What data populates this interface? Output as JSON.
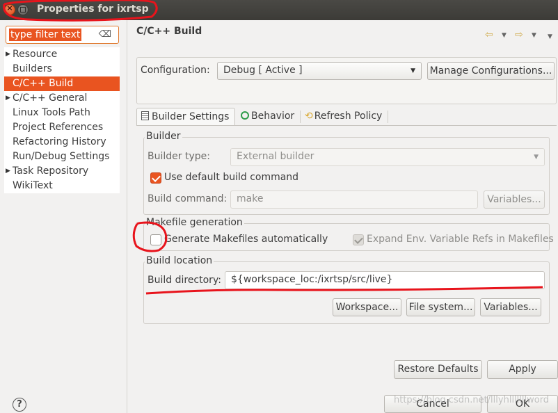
{
  "window": {
    "title": "Properties for ixrtsp"
  },
  "filter": {
    "placeholder": "type filter text",
    "clear_icon": "clear-icon"
  },
  "tree": {
    "items": [
      {
        "label": "Resource",
        "has_children": true
      },
      {
        "label": "Builders",
        "has_children": false
      },
      {
        "label": "C/C++ Build",
        "has_children": false,
        "selected": true
      },
      {
        "label": "C/C++ General",
        "has_children": true
      },
      {
        "label": "Linux Tools Path",
        "has_children": false
      },
      {
        "label": "Project References",
        "has_children": false
      },
      {
        "label": "Refactoring History",
        "has_children": false
      },
      {
        "label": "Run/Debug Settings",
        "has_children": false
      },
      {
        "label": "Task Repository",
        "has_children": true
      },
      {
        "label": "WikiText",
        "has_children": false
      }
    ]
  },
  "page": {
    "title": "C/C++ Build"
  },
  "configuration": {
    "label": "Configuration:",
    "value": "Debug  [ Active ]",
    "manage_button": "Manage Configurations..."
  },
  "tabs": [
    {
      "label": "Builder Settings",
      "icon": "builder-settings-icon",
      "active": true
    },
    {
      "label": "Behavior",
      "icon": "behavior-icon"
    },
    {
      "label": "Refresh Policy",
      "icon": "refresh-policy-icon"
    }
  ],
  "builder": {
    "group_label": "Builder",
    "type_label": "Builder type:",
    "type_value": "External builder",
    "use_default_label": "Use default build command",
    "use_default_checked": true,
    "command_label": "Build command:",
    "command_value": "make",
    "variables_button": "Variables..."
  },
  "makefile": {
    "group_label": "Makefile generation",
    "generate_label": "Generate Makefiles automatically",
    "generate_checked": false,
    "expand_label": "Expand Env. Variable Refs in Makefiles",
    "expand_checked": true
  },
  "build_location": {
    "group_label": "Build location",
    "directory_label": "Build directory:",
    "directory_value": "${workspace_loc:/ixrtsp/src/live}",
    "workspace_button": "Workspace...",
    "filesystem_button": "File system...",
    "variables_button": "Variables..."
  },
  "footer": {
    "restore_button": "Restore Defaults",
    "apply_button": "Apply",
    "cancel_button": "Cancel",
    "ok_button": "OK",
    "help_icon": "?",
    "watermark": "https://blog.csdn.net/lllyhlllllllword"
  },
  "colors": {
    "accent": "#e95420",
    "annotation": "#e8141c"
  }
}
